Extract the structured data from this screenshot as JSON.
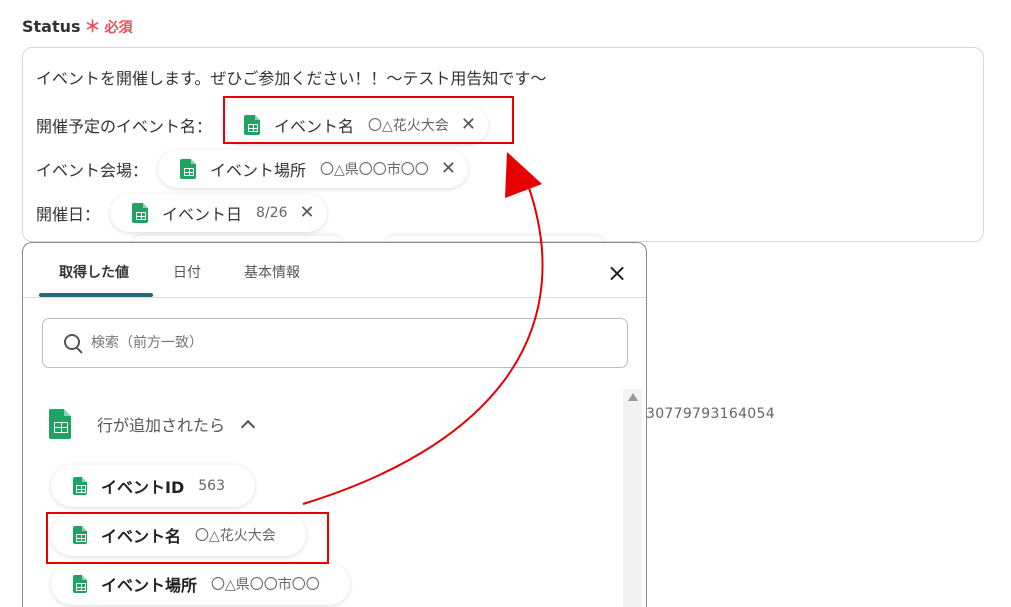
{
  "field": {
    "label": "Status",
    "required_mark": "＊",
    "required_text": "必須"
  },
  "editor": {
    "line1": "イベントを開催します。ぜひご参加ください！！〜テスト用告知です〜",
    "line2_prefix": "開催予定のイベント名：",
    "line3_prefix": "イベント会場：",
    "line4_prefix": "開催日：",
    "chips": [
      {
        "name": "イベント名",
        "value": "〇△花火大会"
      },
      {
        "name": "イベント場所",
        "value": "〇△県〇〇市〇〇"
      },
      {
        "name": "イベント日",
        "value": "8/26"
      }
    ]
  },
  "background_id_text": "30779793164054",
  "panel": {
    "tabs": [
      "取得した値",
      "日付",
      "基本情報"
    ],
    "active_tab": 0,
    "close_icon": "×",
    "search_placeholder": "検索（前方一致）",
    "section_title": "行が追加されたら",
    "items": [
      {
        "name": "イベントID",
        "value": "563"
      },
      {
        "name": "イベント名",
        "value": "〇△花火大会"
      },
      {
        "name": "イベント場所",
        "value": "〇△県〇〇市〇〇"
      }
    ]
  },
  "colors": {
    "accent_tab": "#226a7e",
    "required": "#e8505b",
    "annotation": "#e60000",
    "sheets_green": "#1ea362"
  },
  "icons": {
    "chip_icon": "google-sheets-icon",
    "remove": "close-icon",
    "search": "search-icon",
    "collapse": "chevron-up-icon"
  }
}
